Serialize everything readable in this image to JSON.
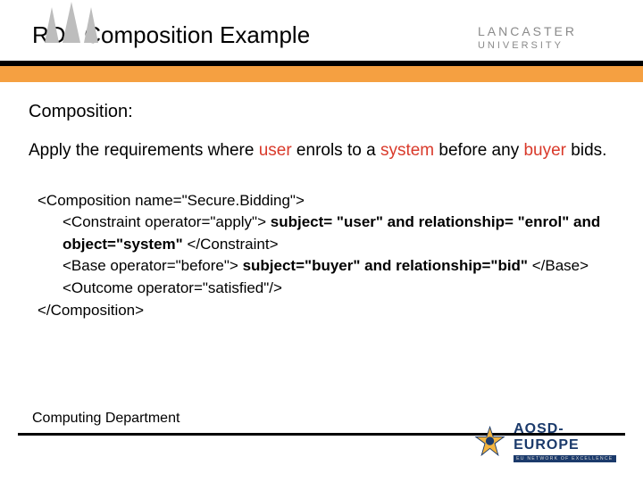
{
  "slide": {
    "title": "RDL Composition Example",
    "subheading": "Composition:",
    "sentence": {
      "p1": "Apply the requirements where ",
      "hl1": "user",
      "p2": " enrols to a ",
      "hl2": "system",
      "p3": " before any ",
      "hl3": "buyer",
      "p4": " bids."
    },
    "code": {
      "l1": "<Composition name=\"Secure.Bidding\">",
      "l2a": "<Constraint operator=\"apply\"> ",
      "l2b": "subject= \"user\" and relationship= \"enrol\" and object=\"system\"",
      "l2c": " </Constraint>",
      "l3a": "<Base operator=\"before\"> ",
      "l3b": "subject=\"buyer\" and relationship=\"bid\"",
      "l3c": " </Base>",
      "l4": "<Outcome operator=\"satisfied\"/>",
      "l5": "</Composition>"
    }
  },
  "branding": {
    "uni_line1": "LANCASTER",
    "uni_line2": "UNIVERSITY",
    "dept": "Computing Department",
    "footer_logo_text": "AOSD-EUROPE",
    "footer_logo_tag": "EU NETWORK OF EXCELLENCE"
  }
}
